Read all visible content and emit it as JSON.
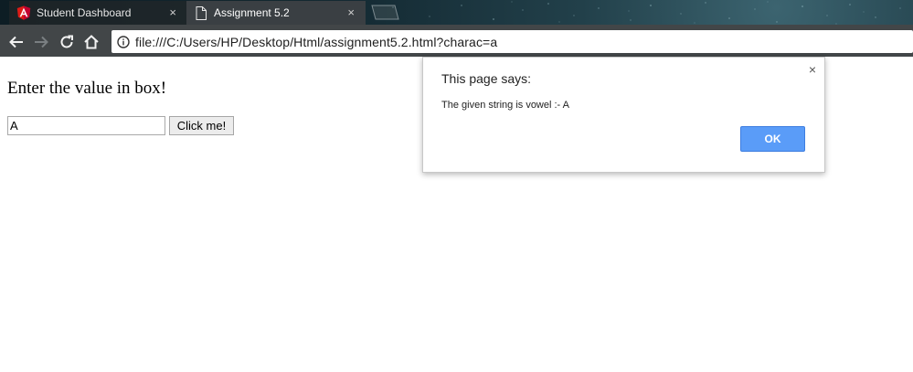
{
  "browser": {
    "tabs": [
      {
        "title": "Student Dashboard",
        "icon": "angular-logo-icon",
        "active": false
      },
      {
        "title": "Assignment 5.2",
        "icon": "document-icon",
        "active": true
      }
    ],
    "close_glyph": "×",
    "url": "file:///C:/Users/HP/Desktop/Html/assignment5.2.html?charac=a"
  },
  "page": {
    "heading": "Enter the value in box!",
    "input_value": "A",
    "button_label": "Click me!"
  },
  "dialog": {
    "title": "This page says:",
    "message": "The given string is vowel :- A",
    "ok_label": "OK",
    "close_glyph": "×"
  },
  "colors": {
    "tab_active_bg": "#3a3f43",
    "angular_red": "#dd1b16",
    "ok_button": "#5a9cf8"
  }
}
